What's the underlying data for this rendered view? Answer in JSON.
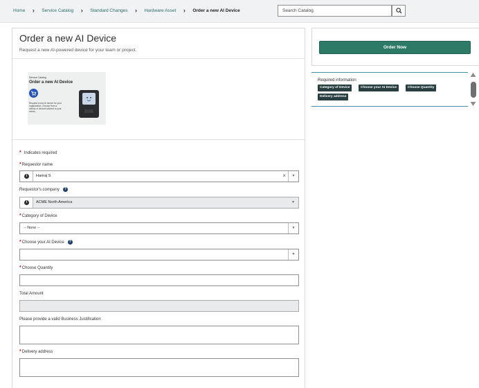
{
  "breadcrumb": {
    "items": [
      "Home",
      "Service Catalog",
      "Standard Changes",
      "Hardware Asset"
    ],
    "current": "Order a new AI Device"
  },
  "search": {
    "value": "Search Catalog",
    "icon": "search-icon"
  },
  "form": {
    "title": "Order a new AI Device",
    "subtitle": "Request a new AI-powered device for your team or project.",
    "hero": {
      "brand": "Service Catalog",
      "title": "Order a new AI Device",
      "desc": "Request a new AI device for your organization. Choose from a variety of devices tailored to your needs."
    },
    "required_note": "Indicates required",
    "fields": {
      "requestor_name": {
        "label": "Requestor name",
        "value": "Hariraj S",
        "required": true
      },
      "requestor_company": {
        "label": "Requestor's company",
        "value": "ACME North America",
        "readonly": true
      },
      "category": {
        "label": "Category of Device",
        "value": "-- None --",
        "required": true
      },
      "ai_device": {
        "label": "Choose your AI Device",
        "value": "",
        "required": true
      },
      "quantity": {
        "label": "Choose Quantity",
        "value": "",
        "required": true
      },
      "total_amount": {
        "label": "Total Amount",
        "value": "",
        "readonly": true
      },
      "justification": {
        "label": "Please provide a valid Business Justification",
        "value": ""
      },
      "delivery": {
        "label": "Delivery address",
        "value": "",
        "required": true
      }
    }
  },
  "order": {
    "button_label": "Order Now",
    "button_color": "#2d7b67"
  },
  "required_info": {
    "title": "Required information",
    "tags": [
      "Category of Device",
      "Choose your AI Device",
      "Choose Quantity",
      "Delivery address"
    ]
  },
  "colors": {
    "accent": "#2d7b67",
    "link": "#2b6d6a",
    "required": "#c8102e",
    "tag_bg": "#293e40",
    "help_icon": "#21406b"
  }
}
